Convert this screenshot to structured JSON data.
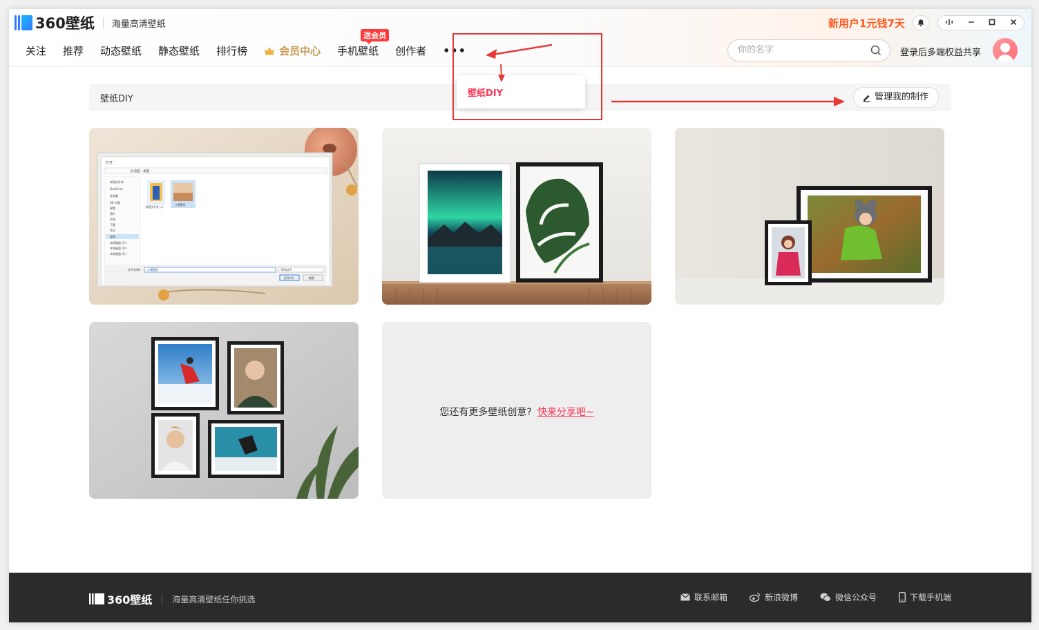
{
  "brand": {
    "logo_text": "360壁纸",
    "slogan": "海量高清壁纸",
    "brand_colors": [
      "#2f7bff",
      "#1bb6ff",
      "#ff5a1f"
    ]
  },
  "promo": {
    "text": "新用户1元钱7天"
  },
  "window_controls": [
    "bell-icon",
    "skin-icon",
    "minimize-icon",
    "maximize-icon",
    "close-icon"
  ],
  "nav": {
    "items": [
      {
        "label": "关注"
      },
      {
        "label": "推荐"
      },
      {
        "label": "动态壁纸"
      },
      {
        "label": "静态壁纸"
      },
      {
        "label": "排行榜"
      },
      {
        "label": "会员中心",
        "icon": "crown-icon"
      },
      {
        "label": "手机壁纸",
        "badge": "送会员"
      },
      {
        "label": "创作者"
      }
    ],
    "more_label": "•••"
  },
  "dropdown": {
    "item_label": "壁纸DIY"
  },
  "search": {
    "placeholder": "你的名字",
    "value": ""
  },
  "user": {
    "login_text": "登录后多端权益共享"
  },
  "toolbar": {
    "title": "壁纸DIY",
    "manage_label": "管理我的制作"
  },
  "cards": [
    {
      "name": "card-desktop-file-dialog",
      "scene": "file-dialog"
    },
    {
      "name": "card-aurora-monstera-frames",
      "scene": "frames-pair"
    },
    {
      "name": "card-child-photo-frames",
      "scene": "child-frames"
    },
    {
      "name": "card-photo-wall",
      "scene": "photo-wall"
    }
  ],
  "cta": {
    "text": "您还有更多壁纸创意?",
    "link": "快来分享吧~"
  },
  "footer": {
    "logo_text": "360壁纸",
    "slogan": "海量高清壁纸任你挑选",
    "links": [
      {
        "label": "联系邮箱",
        "icon": "mail-icon"
      },
      {
        "label": "新浪微博",
        "icon": "weibo-icon"
      },
      {
        "label": "微信公众号",
        "icon": "wechat-icon"
      },
      {
        "label": "下载手机端",
        "icon": "phone-icon"
      }
    ]
  },
  "file_dialog": {
    "title": "打开",
    "path": "此电脑 › 桌面",
    "sidebar": [
      "新建文件夹",
      "OneDrive",
      "此电脑",
      "3D 对象",
      "视频",
      "图片",
      "文档",
      "下载",
      "音乐",
      "桌面",
      "本地磁盘 (C:)",
      "本地磁盘 (D:)",
      "本地磁盘 (E:)"
    ],
    "files": [
      "新建文件夹 (2)",
      "沙漠壁纸"
    ],
    "filename_label": "文件名(N):",
    "filename_value": "沙漠壁纸",
    "filetype_value": "所有文件",
    "open_label": "打开(O)",
    "cancel_label": "取消"
  }
}
